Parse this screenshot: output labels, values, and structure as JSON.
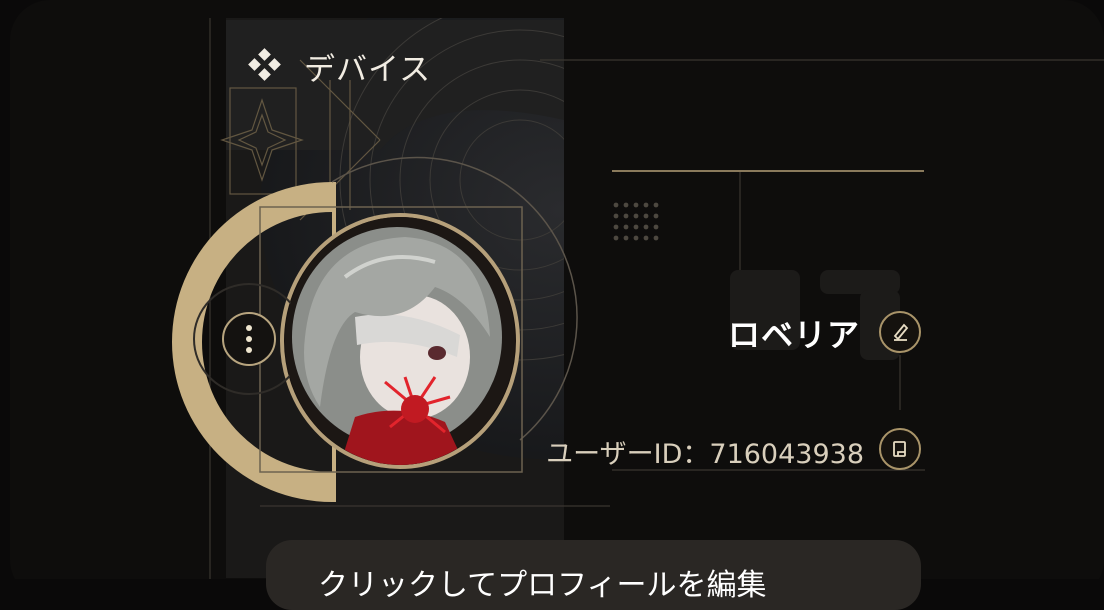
{
  "section": {
    "title": "デバイス",
    "icon": "diamond-icon"
  },
  "profile": {
    "name": "ロベリア",
    "user_id_label": "ユーザーID：",
    "user_id": "716043938",
    "edit_profile_label": "クリックしてプロフィールを編集"
  },
  "icons": {
    "menu": "more-vertical-icon",
    "edit": "pencil-icon",
    "copy": "copy-icon"
  },
  "colors": {
    "background": "#0a0909",
    "accent_gold": "#c8b083",
    "text": "#ffffff"
  }
}
